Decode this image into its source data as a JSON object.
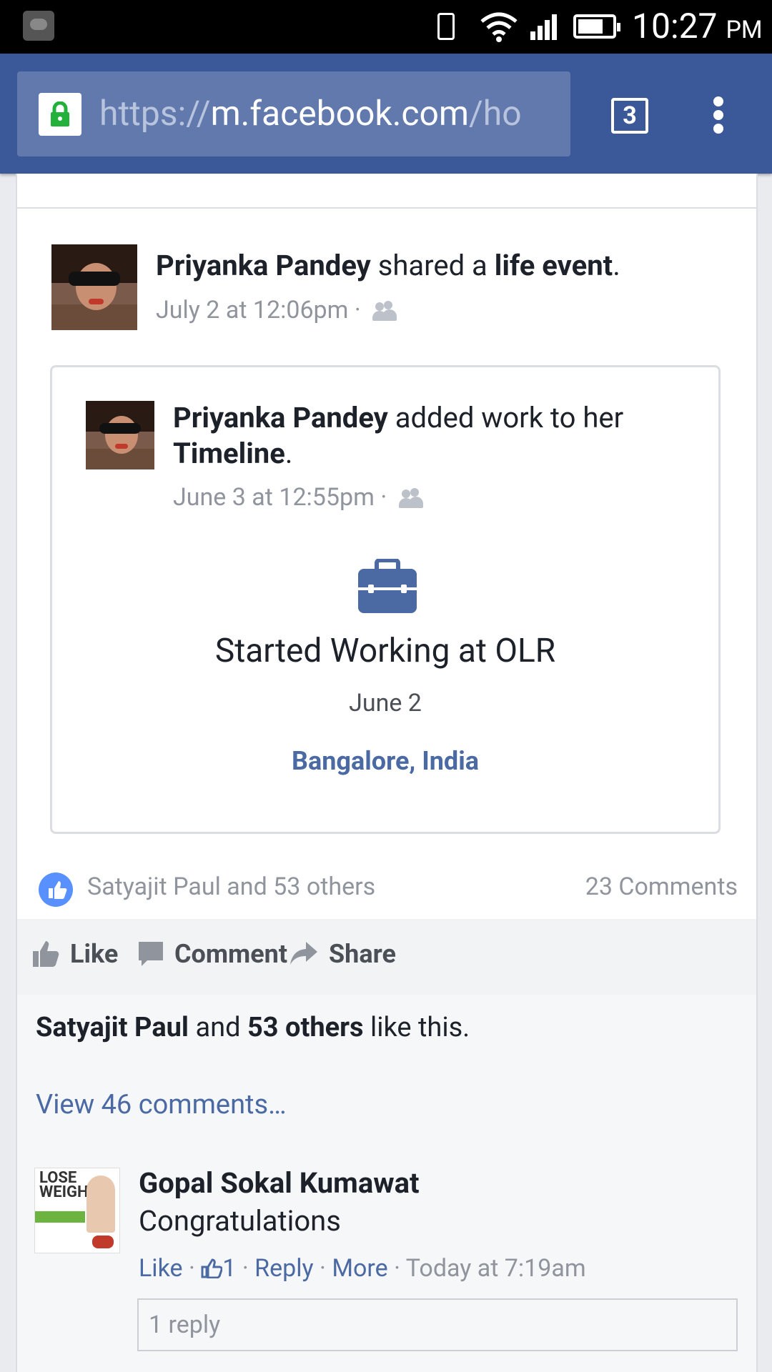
{
  "status_bar": {
    "time": "10:27",
    "ampm": "PM"
  },
  "browser": {
    "url_scheme": "https://",
    "url_host": "m.facebook.com",
    "url_path": "/ho",
    "tab_count": "3"
  },
  "post": {
    "author": "Priyanka Pandey",
    "action_text": "shared a",
    "event_word": "life event",
    "period": ".",
    "timestamp": "July 2 at 12:06pm",
    "separator": "·",
    "shared": {
      "author": "Priyanka Pandey",
      "action_text": "added work to her",
      "target": "Timeline",
      "period": ".",
      "timestamp": "June 3 at 12:55pm",
      "separator": "·",
      "event_title": "Started Working at OLR",
      "event_date": "June 2",
      "event_location": "Bangalore, India"
    },
    "reactions_text": "Satyajit Paul and 53 others",
    "comments_count": "23 Comments",
    "actions": {
      "like": "Like",
      "comment": "Comment",
      "share": "Share"
    },
    "likes_summary": {
      "name": "Satyajit Paul",
      "and": "and",
      "others": "53 others",
      "tail": "like this."
    },
    "view_comments": "View 46 comments…",
    "comment": {
      "author": "Gopal Sokal Kumawat",
      "text": "Congratulations",
      "like": "Like",
      "dot": "·",
      "like_count": "1",
      "reply": "Reply",
      "more": "More",
      "time": "Today at 7:19am",
      "replies": "1 reply",
      "thumb_text": "LOSE WEIGHT"
    }
  },
  "colors": {
    "brand": "#3b5998",
    "link": "#4b6aa3",
    "meta": "#90949c"
  }
}
